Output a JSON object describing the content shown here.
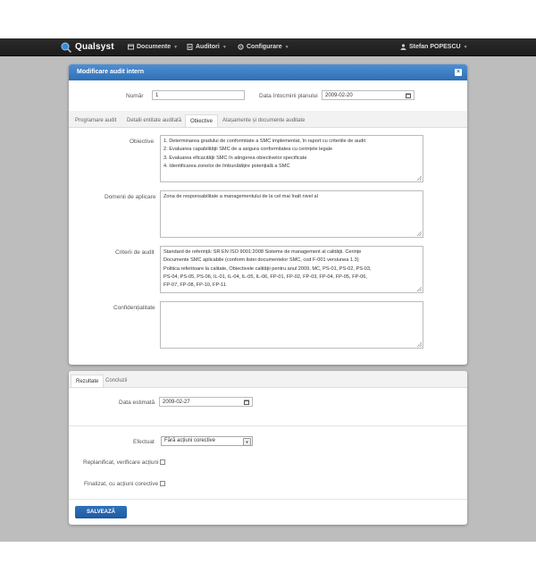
{
  "app": {
    "name": "Qualsyst"
  },
  "nav": {
    "documents": "Documente",
    "audits": "Auditori",
    "config": "Configurare",
    "user": "Stefan POPESCU"
  },
  "modal": {
    "title": "Modificare audit intern",
    "number_label": "Număr",
    "number_value": "1",
    "date_label": "Data întocmirii planului",
    "date_value": "2009-02-20",
    "tabs": [
      "Programare audit",
      "Detalii entitate auditată",
      "Obiective",
      "Atașamente și documente auditate"
    ],
    "active_tab": "Obiective",
    "objectives_label": "Obiective",
    "objectives_lines": [
      "1. Determinarea gradului de conformitate a SMC implementat, în raport cu criteriile de audit",
      "2. Evaluarea capabilității SMC de a asigura conformitatea cu cerințele legale",
      "3. Evaluarea eficacității SMC în atingerea obiectivelor specificate",
      "4. Identificarea zonelor de îmbunătățire potențială a SMC"
    ],
    "scope_label": "Domenii de aplicare",
    "scope_value": "Zona de responsabilitate a managementului de la cel mai înalt nivel al",
    "criteria_label": "Criterii de audit",
    "criteria_lines": [
      "Standard de referință: SR EN ISO 9001:2008 Sisteme de management al calității. Cerințe",
      "Documente SMC aplicabile (conform listei documentelor SMC, cod F-001 versiunea 1.3)",
      "Politica referitoare la calitate, Obiectivele calității pentru anul 2009, MC, PS-01, PS-02, PS-03,",
      "PS-04, PS-05, PS-06, IL-01, IL-04, IL-05, IL-06, FP-01, FP-02, FP-03, FP-04, FP-05, FP-06,",
      "FP-07, FP-08, FP-10, FP-11."
    ],
    "confidentiality_label": "Confidențialitate",
    "confidentiality_value": ""
  },
  "results": {
    "tabs": [
      "Rezultate",
      "Concluzii"
    ],
    "active_tab": "Rezultate",
    "est_date_label": "Data estimată",
    "est_date_value": "2009-02-27",
    "performed_label": "Efectuat",
    "performed_value": "Fără acțiuni corective",
    "replanned_label": "Replanificat, verificare acțiuni",
    "finalized_label": "Finalizat, cu acțiuni corective",
    "save_label": "SALVEAZĂ"
  },
  "colors": {
    "accent": "#2e6fb7",
    "topbar": "#222222",
    "background": "#bdbdbd"
  }
}
